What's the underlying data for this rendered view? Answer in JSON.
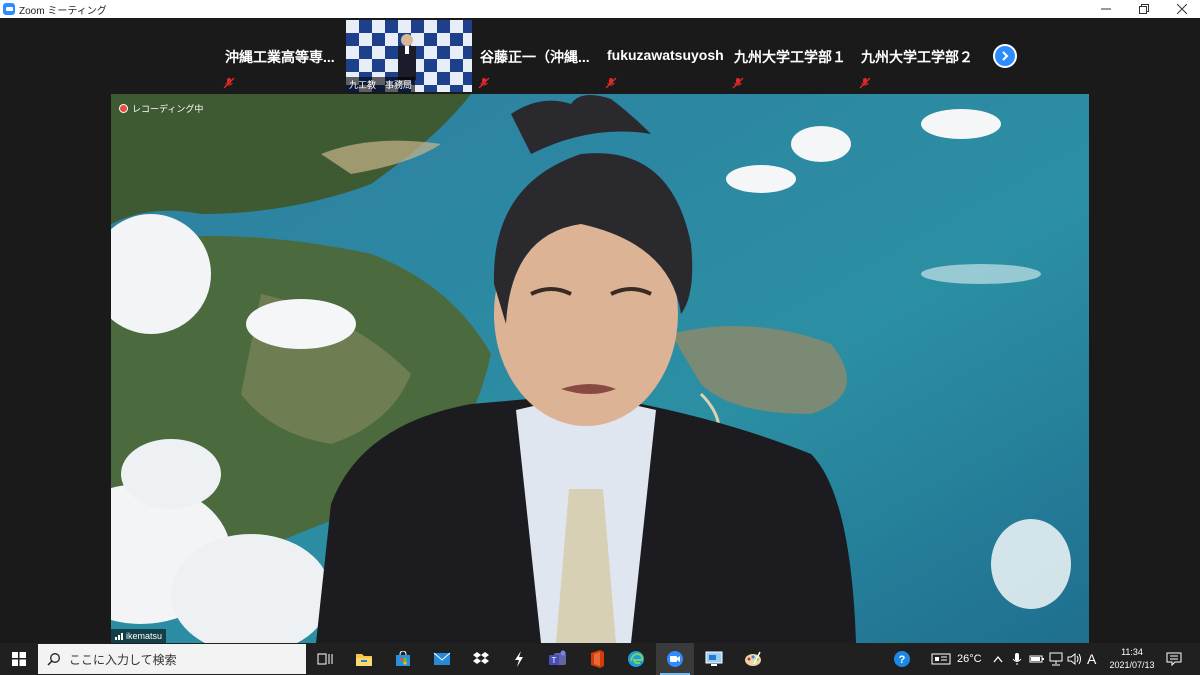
{
  "window": {
    "title": "Zoom ミーティング"
  },
  "participants_strip": [
    {
      "name": "沖縄工業高等専..."
    },
    {
      "name": "九工教　事務局",
      "has_video": true
    },
    {
      "name": "谷藤正一（沖縄..."
    },
    {
      "name": "fukuzawatsuyoshi"
    },
    {
      "name": "九州大学工学部１"
    },
    {
      "name": "九州大学工学部２"
    }
  ],
  "main_video": {
    "recording_label": "レコーディング中",
    "speaker_name": "ikematsu"
  },
  "taskbar": {
    "search_placeholder": "ここに入力して検索",
    "weather": "26°C",
    "ime": "A",
    "time": "11:34",
    "date": "2021/07/13"
  },
  "colors": {
    "zoom_blue": "#2d8cff",
    "recording_red": "#e74c3c",
    "taskbar_bg": "#202020",
    "mute_red": "#e02828"
  },
  "icons": [
    "windows-logo-icon",
    "search-icon",
    "task-view-icon",
    "file-explorer-icon",
    "store-icon",
    "mail-icon",
    "dropbox-icon",
    "terminal-icon",
    "teams-icon",
    "office-icon",
    "edge-icon",
    "zoom-icon",
    "remote-desktop-icon",
    "paint-icon",
    "help-icon",
    "weather-icon",
    "chevron-up-icon",
    "microphone-icon",
    "battery-icon",
    "network-icon",
    "volume-icon",
    "notification-icon",
    "mic-muted-icon",
    "next-page-icon"
  ]
}
